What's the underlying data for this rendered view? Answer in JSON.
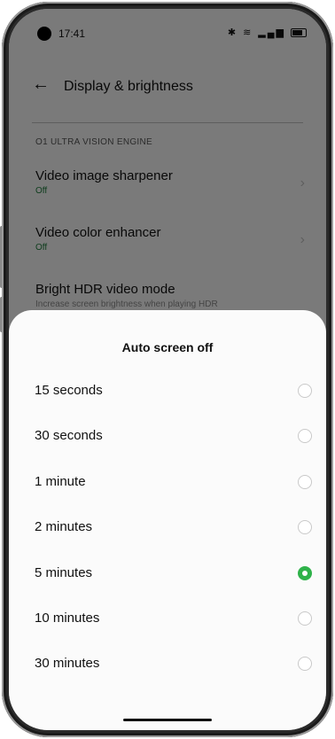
{
  "status": {
    "time": "17:41"
  },
  "appbar": {
    "title": "Display & brightness"
  },
  "section": {
    "title": "O1 ULTRA VISION ENGINE"
  },
  "settings": [
    {
      "title": "Video image sharpener",
      "state": "Off"
    },
    {
      "title": "Video color enhancer",
      "state": "Off"
    },
    {
      "title": "Bright HDR video mode",
      "subtitle": "Increase screen brightness when playing HDR"
    }
  ],
  "sheet": {
    "title": "Auto screen off",
    "options": [
      {
        "label": "15 seconds",
        "selected": false
      },
      {
        "label": "30 seconds",
        "selected": false
      },
      {
        "label": "1 minute",
        "selected": false
      },
      {
        "label": "2 minutes",
        "selected": false
      },
      {
        "label": "5 minutes",
        "selected": true
      },
      {
        "label": "10 minutes",
        "selected": false
      },
      {
        "label": "30 minutes",
        "selected": false
      }
    ]
  },
  "colors": {
    "accent": "#2fb24a",
    "state_green": "#1d7a3a"
  }
}
